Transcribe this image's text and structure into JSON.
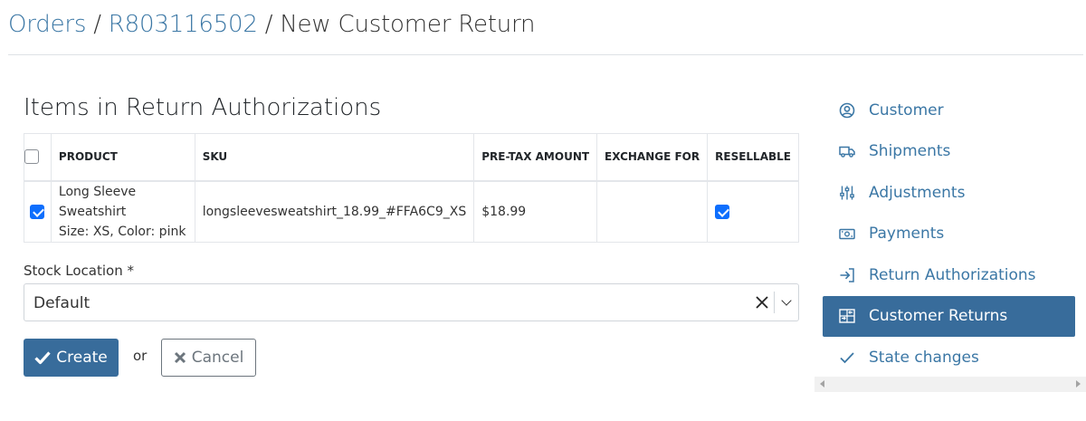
{
  "breadcrumb": {
    "orders": "Orders",
    "separator": "/",
    "order_number": "R803116502",
    "current": "New Customer Return"
  },
  "section_title": "Items in Return Authorizations",
  "table": {
    "headers": [
      "PRODUCT",
      "SKU",
      "PRE-TAX AMOUNT",
      "EXCHANGE FOR",
      "RESELLABLE"
    ],
    "select_all_checked": false,
    "rows": [
      {
        "checked": true,
        "product_name": "Long Sleeve Sweatshirt",
        "product_variant": "Size: XS, Color: pink",
        "sku": "longsleevesweatshirt_18.99_#FFA6C9_XS",
        "pre_tax_amount": "$18.99",
        "exchange_for": "",
        "resellable": true
      }
    ]
  },
  "stock_location": {
    "label": "Stock Location *",
    "value": "Default"
  },
  "actions": {
    "create_label": "Create",
    "or_label": "or",
    "cancel_label": "Cancel"
  },
  "sidebar": {
    "items": [
      {
        "label": "Customer",
        "icon": "user-circle-icon",
        "active": false
      },
      {
        "label": "Shipments",
        "icon": "truck-icon",
        "active": false
      },
      {
        "label": "Adjustments",
        "icon": "sliders-icon",
        "active": false
      },
      {
        "label": "Payments",
        "icon": "cash-icon",
        "active": false
      },
      {
        "label": "Return Authorizations",
        "icon": "return-icon",
        "active": false
      },
      {
        "label": "Customer Returns",
        "icon": "customer-returns-icon",
        "active": true
      },
      {
        "label": "State changes",
        "icon": "check-icon",
        "active": false
      }
    ]
  },
  "colors": {
    "link": "#3b77a5",
    "primary": "#386c9b",
    "checkbox": "#0d6efd"
  }
}
